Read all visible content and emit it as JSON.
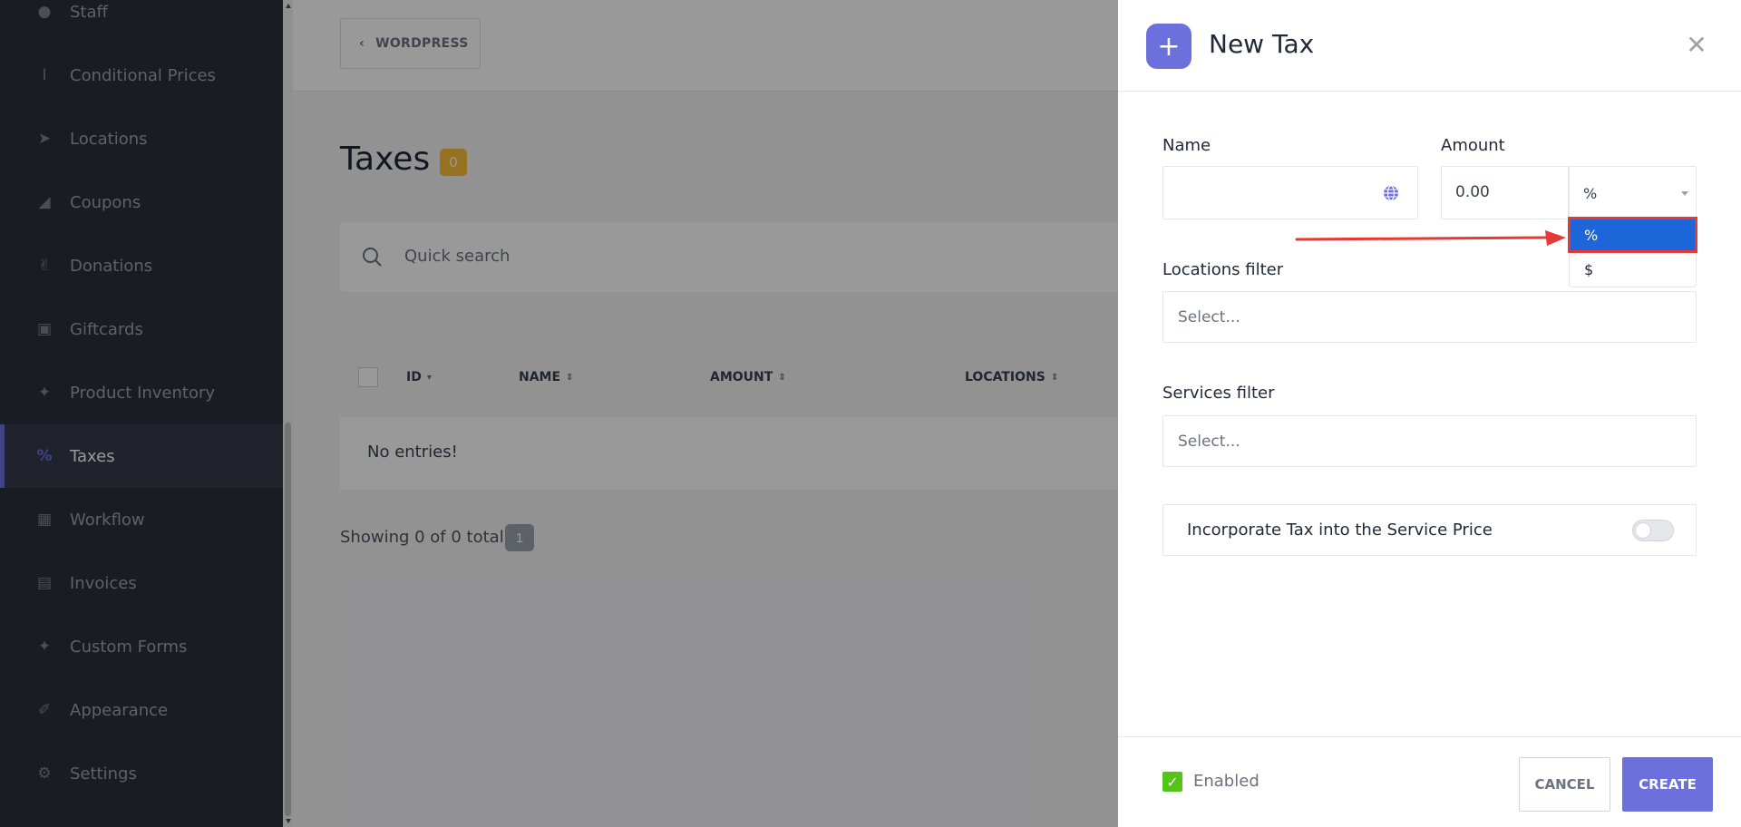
{
  "sidebar": {
    "items": [
      {
        "label": "Staff",
        "icon": "user-icon"
      },
      {
        "label": "Conditional Prices",
        "icon": "text-cursor-icon"
      },
      {
        "label": "Locations",
        "icon": "location-arrow-icon"
      },
      {
        "label": "Coupons",
        "icon": "tag-icon"
      },
      {
        "label": "Donations",
        "icon": "hand-holding-icon"
      },
      {
        "label": "Giftcards",
        "icon": "gift-icon"
      },
      {
        "label": "Product Inventory",
        "icon": "magic-wand-icon"
      },
      {
        "label": "Taxes",
        "icon": "percent-icon",
        "active": true
      },
      {
        "label": "Workflow",
        "icon": "workflow-icon"
      },
      {
        "label": "Invoices",
        "icon": "document-icon"
      },
      {
        "label": "Custom Forms",
        "icon": "magic-wand-icon"
      },
      {
        "label": "Appearance",
        "icon": "brush-icon"
      },
      {
        "label": "Settings",
        "icon": "gear-icon"
      }
    ]
  },
  "topbar": {
    "back_label": "WORDPRESS"
  },
  "page": {
    "title": "Taxes",
    "count": "0",
    "search_placeholder": "Quick search",
    "columns": [
      "ID",
      "NAME",
      "AMOUNT",
      "LOCATIONS"
    ],
    "empty_text": "No entries!",
    "showing_text": "Showing 0 of 0 total",
    "page_number": "1"
  },
  "drawer": {
    "title": "New Tax",
    "name_label": "Name",
    "amount_label": "Amount",
    "amount_value": "0.00",
    "unit_selected": "%",
    "unit_options": [
      "%",
      "$"
    ],
    "locations_label": "Locations filter",
    "locations_placeholder": "Select...",
    "services_label": "Services filter",
    "services_placeholder": "Select...",
    "incorporate_label": "Incorporate Tax into the Service Price",
    "enabled_label": "Enabled",
    "cancel_label": "CANCEL",
    "create_label": "CREATE"
  },
  "colors": {
    "accent": "#6c70dc",
    "sidebar_bg": "#2b2f3a",
    "badge": "#fbbc39",
    "selected_option": "#1c66d9",
    "annotation": "#e53935",
    "enabled_check": "#52c41a"
  }
}
